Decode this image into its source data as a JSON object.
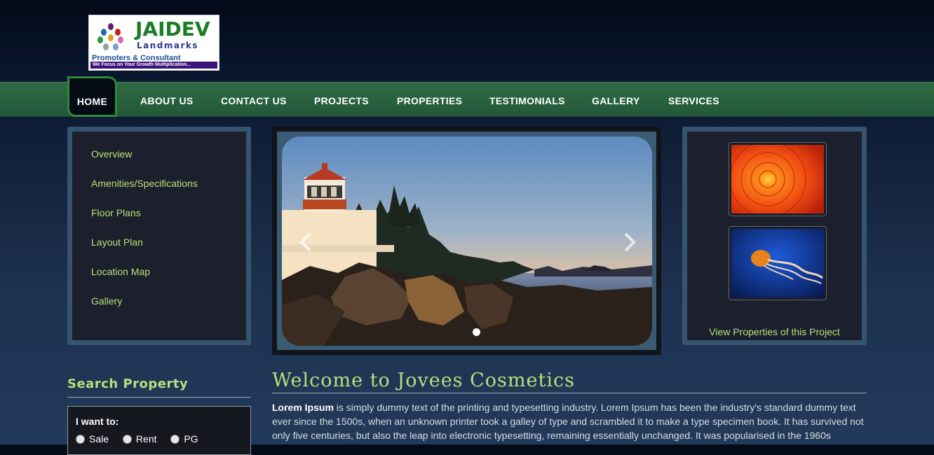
{
  "logo": {
    "brand": "JAIDEV",
    "subtitle": "Landmarks",
    "line2": "Promoters & Consultant",
    "tagline": "We Focus on Your Growth Multiplication..."
  },
  "nav": {
    "items": [
      {
        "label": "HOME"
      },
      {
        "label": "ABOUT US"
      },
      {
        "label": "CONTACT US"
      },
      {
        "label": "PROJECTS"
      },
      {
        "label": "PROPERTIES"
      },
      {
        "label": "TESTIMONIALS"
      },
      {
        "label": "GALLERY"
      },
      {
        "label": "SERVICES"
      }
    ],
    "active": "HOME"
  },
  "sidebar": {
    "links": [
      {
        "label": "Overview"
      },
      {
        "label": "Amenities/Specifications"
      },
      {
        "label": "Floor Plans"
      },
      {
        "label": "Layout Plan"
      },
      {
        "label": "Location Map"
      },
      {
        "label": "Gallery"
      }
    ]
  },
  "slider": {
    "image": "lighthouse-at-sunset",
    "prev_icon": "chevron-left-icon",
    "next_icon": "chevron-right-icon",
    "dot_count": 1
  },
  "right_panel": {
    "thumbnails": [
      "red-dahlia-flower",
      "jellyfish"
    ],
    "link": "View Properties of this Project"
  },
  "search": {
    "title": "Search Property",
    "want_label": "I want to:",
    "options": [
      "Sale",
      "Rent",
      "PG"
    ]
  },
  "main": {
    "heading": "Welcome to Jovees Cosmetics",
    "intro_bold": "Lorem Ipsum",
    "intro_text": " is simply dummy text of the printing and typesetting industry. Lorem Ipsum has been the industry's standard dummy text ever since the 1500s, when an unknown printer took a galley of type and scrambled it to make a type specimen book. It has survived not only five centuries, but also the leap into electronic typesetting, remaining essentially unchanged. It was popularised in the 1960s"
  },
  "colors": {
    "nav_green": "#2a6040",
    "accent_lime": "#b7e07a",
    "panel_border": "#36546f",
    "panel_bg": "#1c1f2c"
  }
}
